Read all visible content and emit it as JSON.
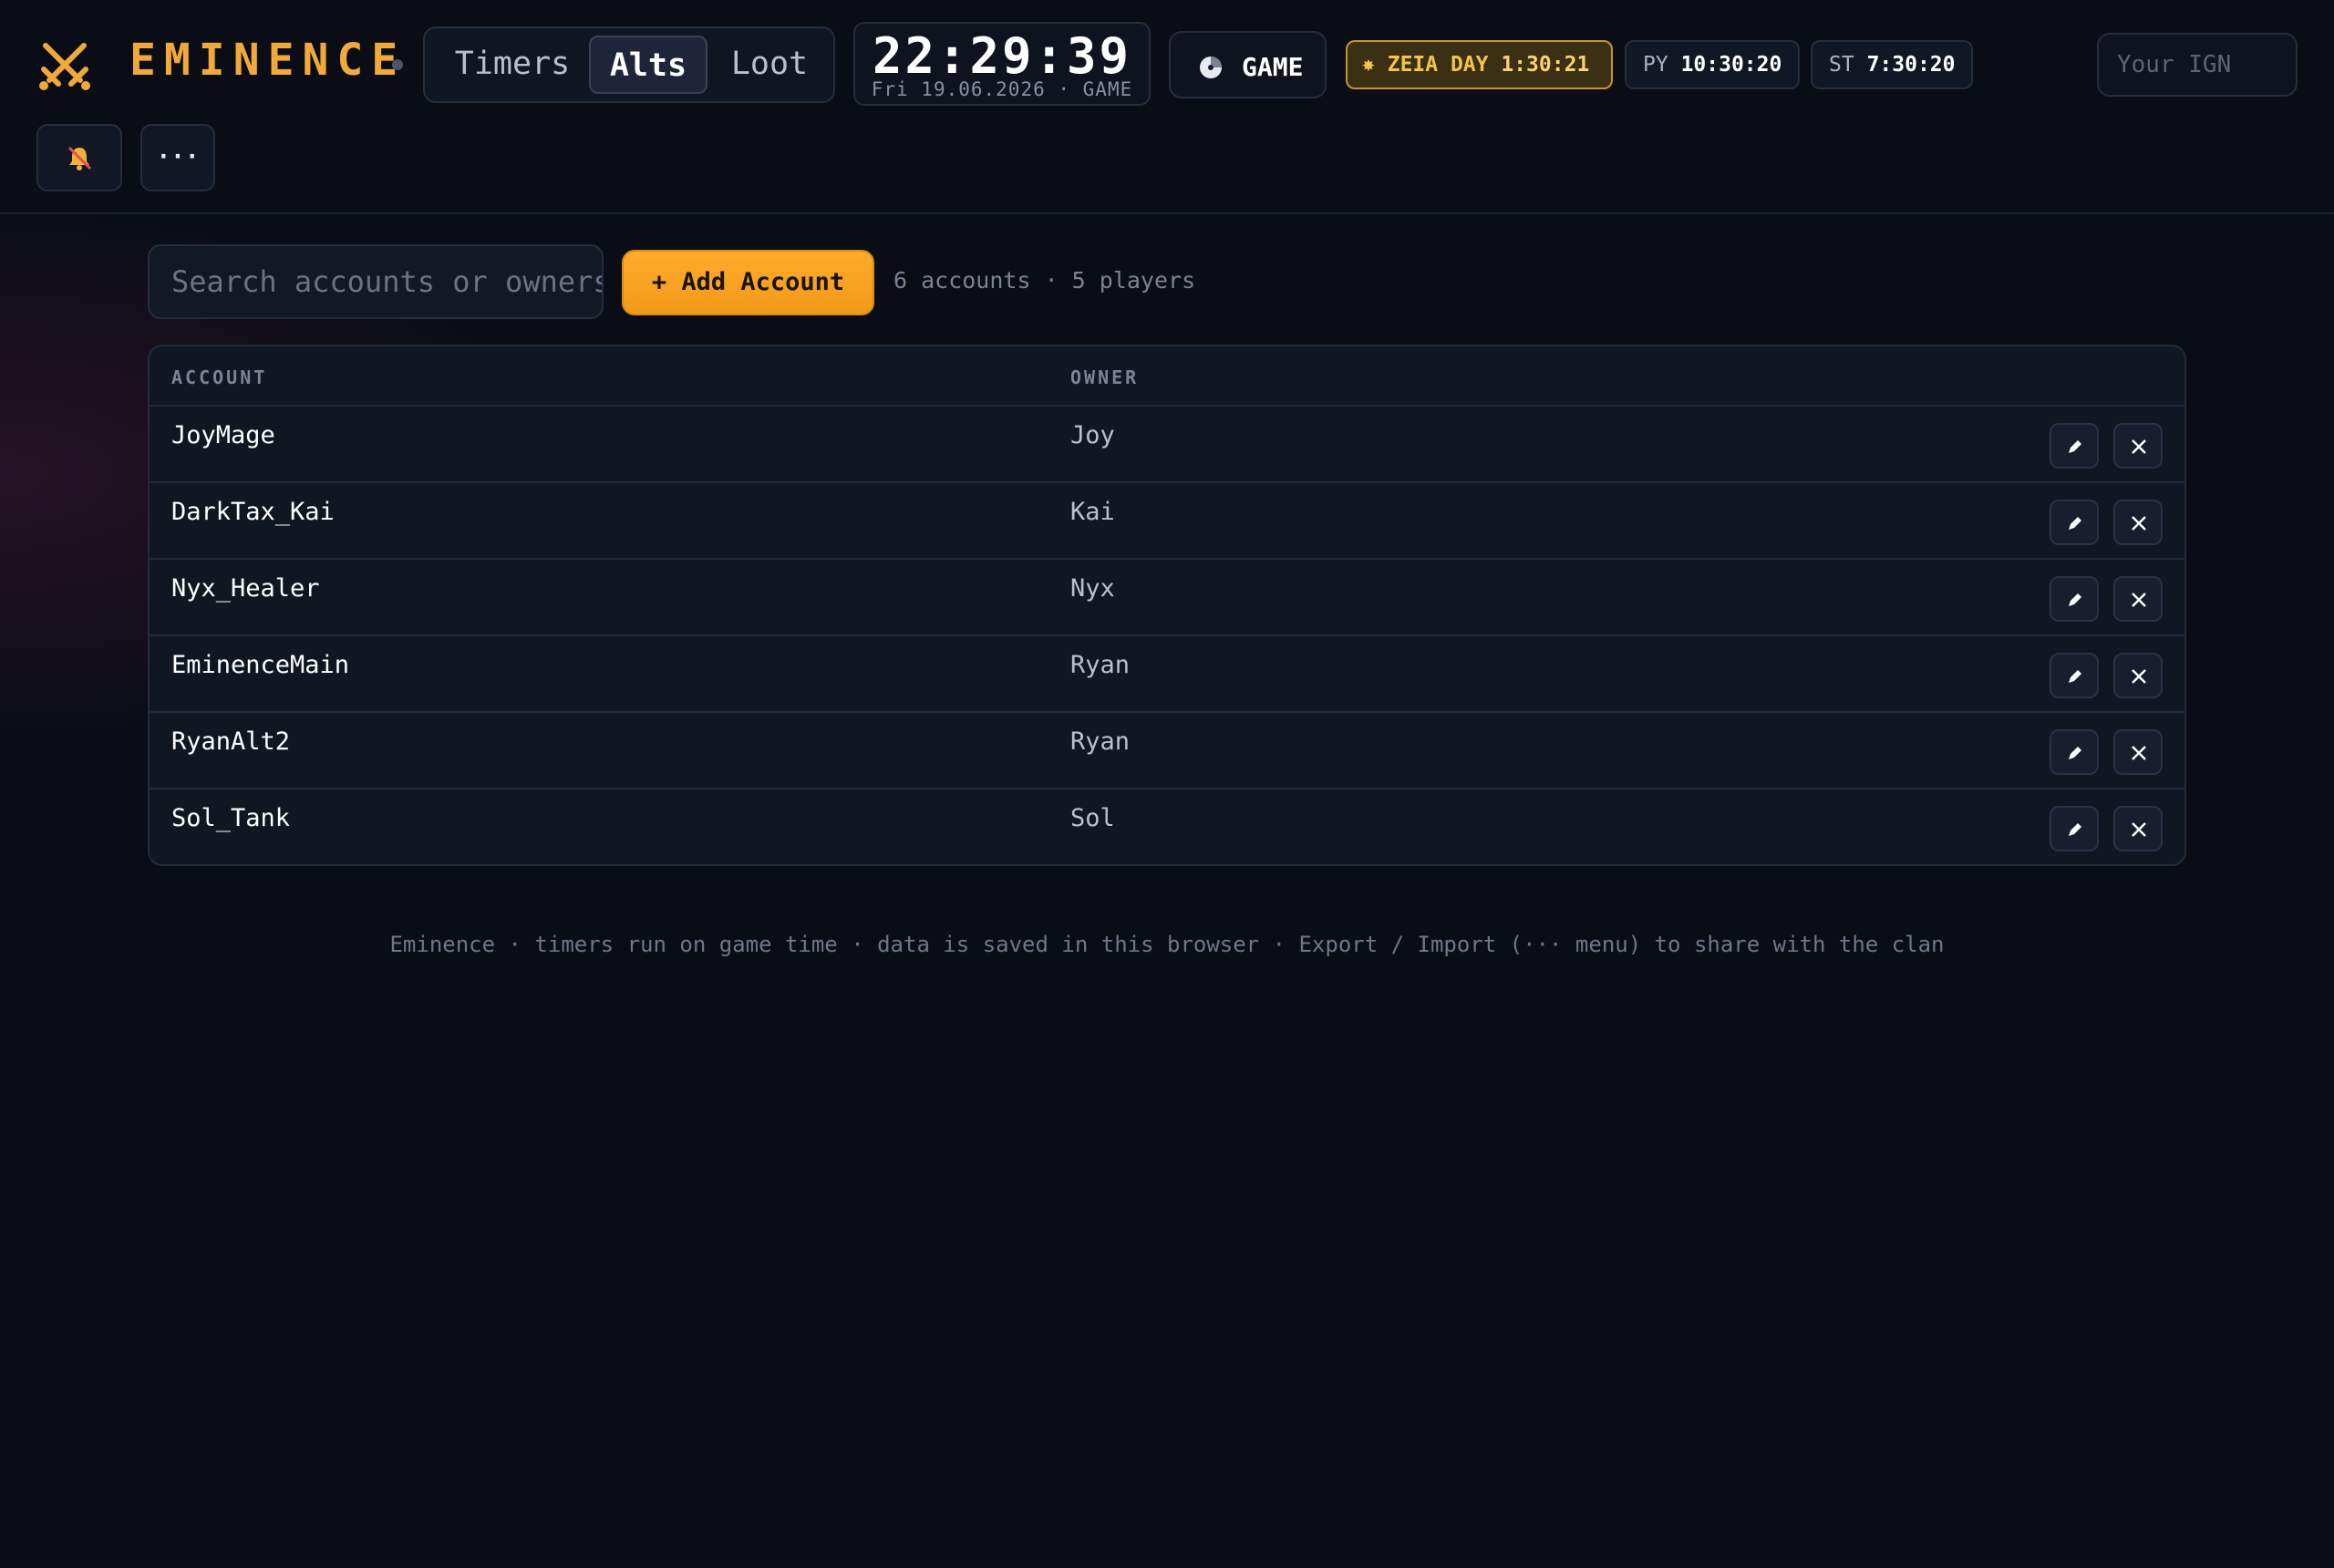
{
  "app": {
    "brand": "EMINENCE",
    "accent_color": "#f2a93b"
  },
  "nav": {
    "tabs": [
      {
        "label": "Timers",
        "active": false
      },
      {
        "label": "Alts",
        "active": true
      },
      {
        "label": "Loot",
        "active": false
      }
    ]
  },
  "clock": {
    "time": "22:29:39",
    "date": "Fri 19.06.2026 · GAME"
  },
  "mode": {
    "label": "GAME",
    "icon": "clock-icon"
  },
  "timers": {
    "zeia": {
      "icon": "sun-icon",
      "label": "ZEIA DAY",
      "value": "1:30:21"
    },
    "py": {
      "label": "PY",
      "value": "10:30:20"
    },
    "st": {
      "label": "ST",
      "value": "7:30:20"
    }
  },
  "ign": {
    "placeholder": "Your IGN",
    "value": ""
  },
  "actions": {
    "bell_icon": "bell-muted-icon",
    "more_label": "···"
  },
  "toolbar": {
    "search_placeholder": "Search accounts or owners",
    "add_label": "+ Add Account",
    "counts": "6 accounts · 5 players"
  },
  "table": {
    "headers": [
      "ACCOUNT",
      "OWNER"
    ],
    "rows": [
      {
        "account": "JoyMage",
        "owner": "Joy"
      },
      {
        "account": "DarkTax_Kai",
        "owner": "Kai"
      },
      {
        "account": "Nyx_Healer",
        "owner": "Nyx"
      },
      {
        "account": "EminenceMain",
        "owner": "Ryan"
      },
      {
        "account": "RyanAlt2",
        "owner": "Ryan"
      },
      {
        "account": "Sol_Tank",
        "owner": "Sol"
      }
    ],
    "row_actions": [
      "edit-icon",
      "close-icon"
    ]
  },
  "footer": {
    "text": "Eminence · timers run on game time · data is saved in this browser · Export / Import (··· menu) to share with the clan"
  }
}
